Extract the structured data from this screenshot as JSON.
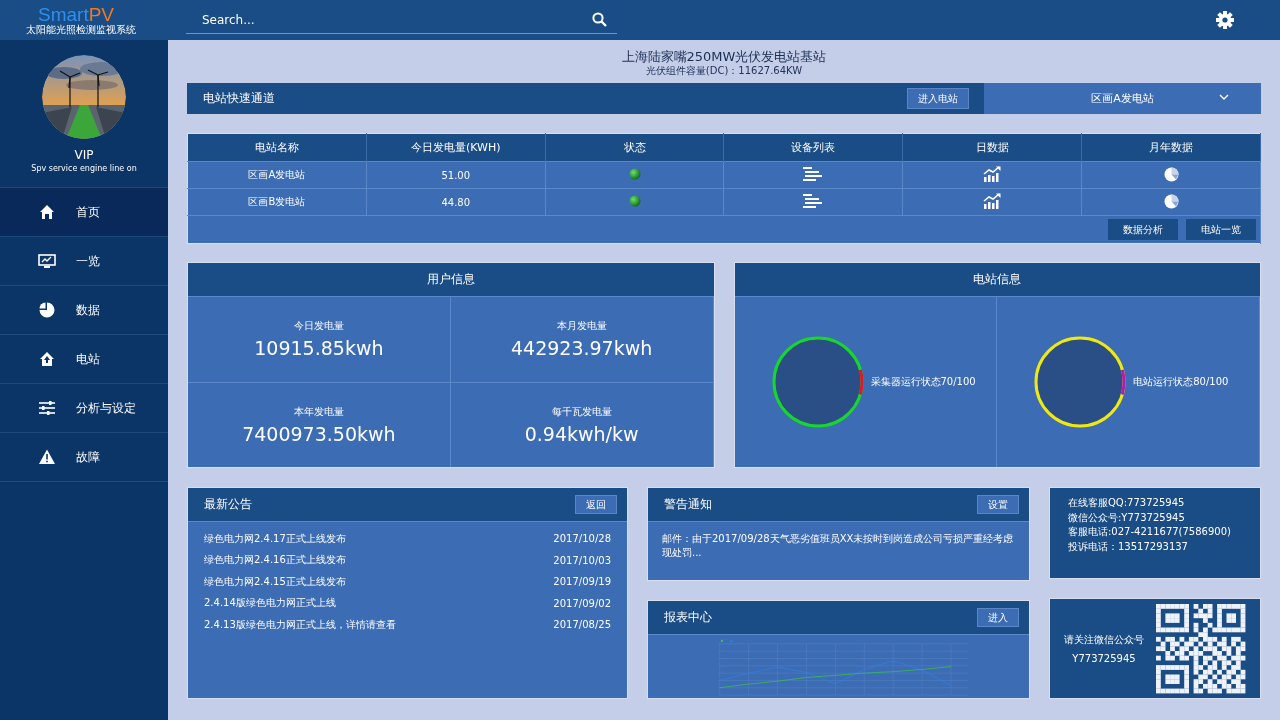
{
  "header": {
    "logo_main": "Smart",
    "logo_accent": "PV",
    "logo_subtitle": "太阳能光照检测监视系统",
    "search": {
      "placeholder": "Search..."
    }
  },
  "sidebar": {
    "profile": {
      "name": "VIP",
      "tagline": "Spv service engine line on"
    },
    "items": [
      {
        "label": "首页",
        "selected": true
      },
      {
        "label": "一览",
        "selected": false
      },
      {
        "label": "数据",
        "selected": false
      },
      {
        "label": "电站",
        "selected": false
      },
      {
        "label": "分析与设定",
        "selected": false
      },
      {
        "label": "故障",
        "selected": false
      }
    ]
  },
  "page": {
    "title": "上海陆家嘴250MW光伏发电站基站",
    "subtitle": "光伏组件容量(DC)：11627.64KW"
  },
  "quick_access": {
    "title": "电站快速通道",
    "button": "进入电站",
    "dropdown": "区画A发电站"
  },
  "table": {
    "columns": [
      "电站名称",
      "今日发电量(KWH)",
      "状态",
      "设备列表",
      "日数据",
      "月年数据"
    ],
    "rows": [
      {
        "name": "区画A发电站",
        "today_kwh": "51.00",
        "online": true
      },
      {
        "name": "区画B发电站",
        "today_kwh": "44.80",
        "online": true
      }
    ],
    "buttons": [
      "数据分析",
      "电站一览"
    ]
  },
  "user_info": {
    "title": "用户信息",
    "stats": [
      {
        "label": "今日发电量",
        "value": "10915.85kwh"
      },
      {
        "label": "本月发电量",
        "value": "442923.97kwh"
      },
      {
        "label": "本年发电量",
        "value": "7400973.50kwh"
      },
      {
        "label": "每千瓦发电量",
        "value": "0.94kwh/kw"
      }
    ]
  },
  "station_info": {
    "title": "电站信息",
    "gauges": [
      {
        "label": "采集器运行状态70/100",
        "color": "#19d62b"
      },
      {
        "label": "电站运行状态80/100",
        "color": "#f0e813"
      }
    ]
  },
  "announcements": {
    "title": "最新公告",
    "button": "返回",
    "items": [
      {
        "text": "绿色电力网2.4.17正式上线发布",
        "date": "2017/10/28"
      },
      {
        "text": "绿色电力网2.4.16正式上线发布",
        "date": "2017/10/03"
      },
      {
        "text": "绿色电力网2.4.15正式上线发布",
        "date": "2017/09/19"
      },
      {
        "text": "2.4.14版绿色电力网正式上线",
        "date": "2017/09/02"
      },
      {
        "text": "2.4.13版绿色电力网正式上线，详情请查看",
        "date": "2017/08/25"
      }
    ]
  },
  "warning": {
    "title": "警告通知",
    "button": "设置",
    "message": "邮件：由于2017/09/28天气恶劣值班员XX未按时到岗造成公司亏损严重经考虑现处罚..."
  },
  "reports": {
    "title": "报表中心",
    "button": "进入"
  },
  "contact": {
    "lines": [
      "在线客服QQ:773725945",
      "微信公众号:Y773725945",
      "客服电话:027-4211677(7586900)",
      "投诉电话：13517293137"
    ]
  },
  "wechat": {
    "lines": [
      "请关注微信公众号",
      "Y773725945"
    ]
  }
}
